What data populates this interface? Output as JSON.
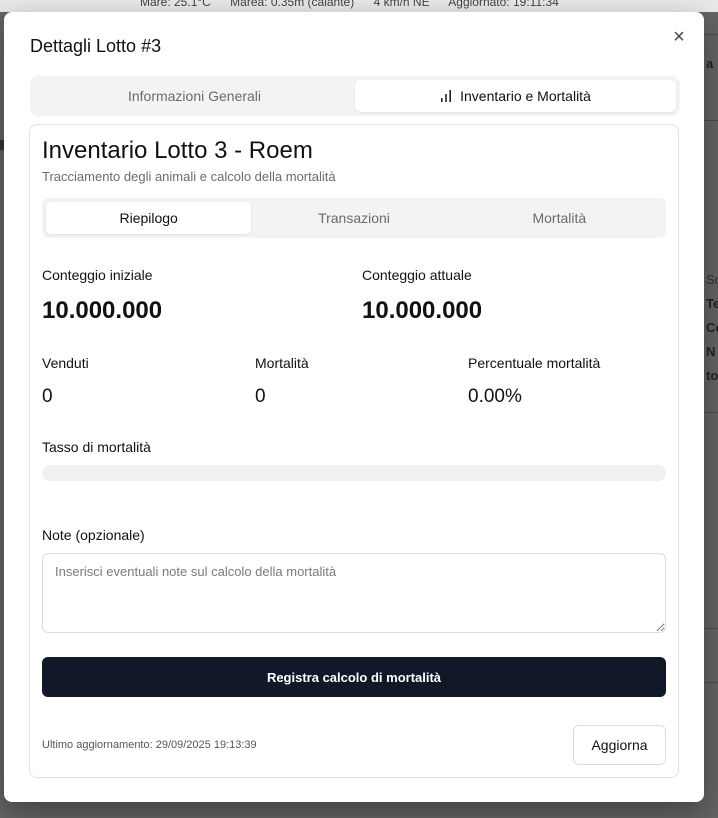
{
  "background": {
    "weather": {
      "temperature": "Mare: 25.1°C",
      "tide": "Marea: 0.35m (calante)",
      "wind": "4 km/h NE",
      "updated": "Aggiornato: 19:11:34"
    },
    "right_fragments": [
      "a",
      "Sc",
      "Te",
      "Co",
      "N",
      "to"
    ]
  },
  "modal": {
    "title": "Dettagli Lotto #3",
    "close_symbol": "×",
    "tabs": [
      {
        "label": "Informazioni Generali",
        "active": false
      },
      {
        "label": "Inventario e Mortalità",
        "active": true,
        "icon": "bar-chart-icon"
      }
    ]
  },
  "inventory": {
    "title": "Inventario Lotto 3 - Roem",
    "subtitle": "Tracciamento degli animali e calcolo della mortalità",
    "sub_tabs": [
      {
        "label": "Riepilogo",
        "active": true
      },
      {
        "label": "Transazioni",
        "active": false
      },
      {
        "label": "Mortalità",
        "active": false
      }
    ],
    "initial_count_label": "Conteggio iniziale",
    "initial_count_value": "10.000.000",
    "current_count_label": "Conteggio attuale",
    "current_count_value": "10.000.000",
    "sold_label": "Venduti",
    "sold_value": "0",
    "mortality_label": "Mortalità",
    "mortality_value": "0",
    "mortality_pct_label": "Percentuale mortalità",
    "mortality_pct_value": "0.00%",
    "mortality_rate_label": "Tasso di mortalità",
    "mortality_rate_fraction": 0,
    "notes_label": "Note (opzionale)",
    "notes_placeholder": "Inserisci eventuali note sul calcolo della mortalità",
    "notes_value": "",
    "submit_label": "Registra calcolo di mortalità",
    "last_update": "Ultimo aggiornamento: 29/09/2025 19:13:39",
    "refresh_label": "Aggiorna"
  },
  "colors": {
    "primary": "#111827",
    "muted_text": "#6b6b6b",
    "tab_bg": "#f3f3f3"
  }
}
